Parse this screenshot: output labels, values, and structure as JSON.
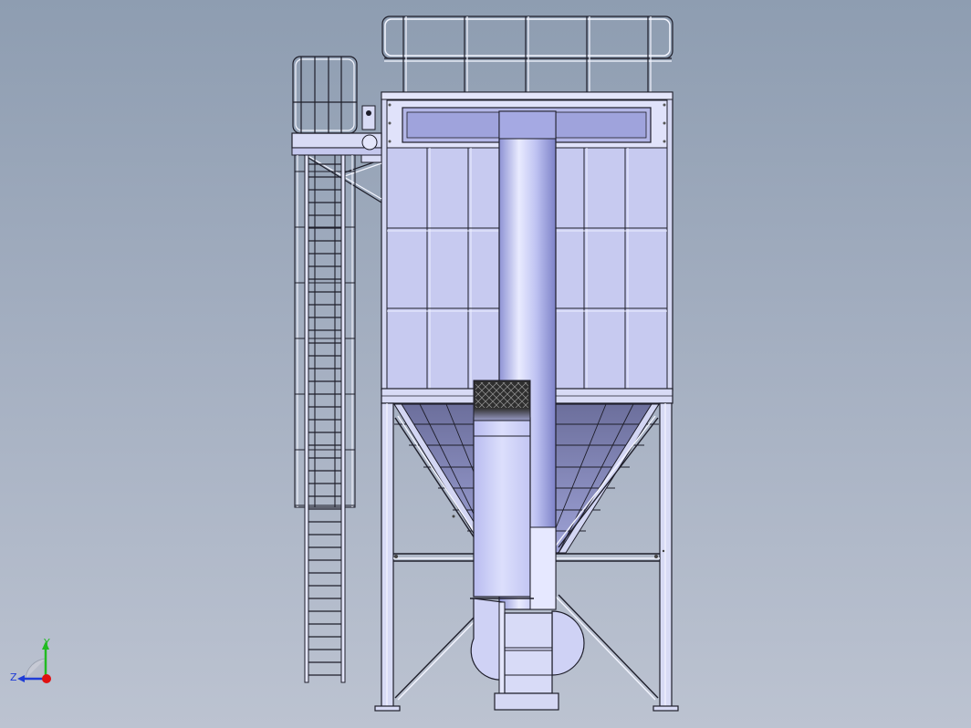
{
  "viewport": {
    "background_top": "#8e9db1",
    "background_bottom": "#bcc3d1"
  },
  "model": {
    "type": "dust collector assembly",
    "view": "front",
    "components": [
      "top-guardrail",
      "filter-housing",
      "inlet-duct",
      "mesh-screen",
      "conical-hopper",
      "support-legs",
      "cross-bracing",
      "access-ladder",
      "ladder-cage",
      "service-platform",
      "fan-housing"
    ],
    "colors": {
      "body": "#d6d9f3",
      "panel": "#c6c8ee",
      "duct_light": "#e6e8ff",
      "duct_dark": "#8a8ed0",
      "hopper_dark": "#6e719f",
      "outline": "#1e1e2a",
      "mesh": "#3a3a3a"
    }
  },
  "triad": {
    "y_label": "Y",
    "z_label": "Z",
    "y_color": "#22bb22",
    "z_color": "#1f3cd6",
    "x_color": "#e01010"
  }
}
